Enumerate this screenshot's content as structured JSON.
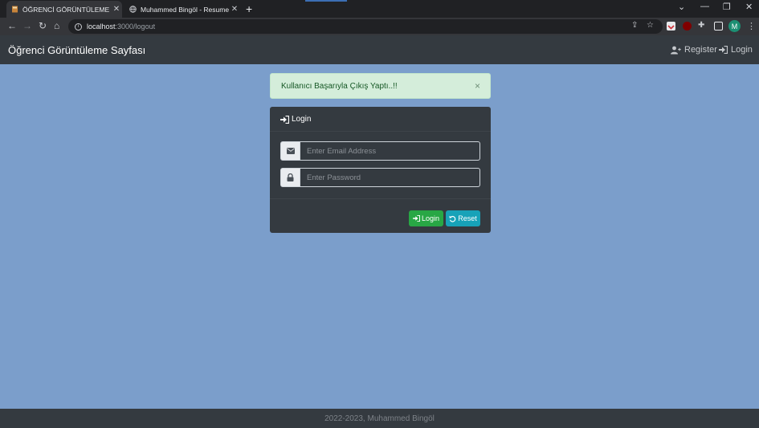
{
  "browser": {
    "tabs": [
      {
        "title": "ÖĞRENCİ GÖRÜNTÜLEME SAYFASI",
        "active": true
      },
      {
        "title": "Muhammed Bingöl - Resume Page",
        "active": false
      }
    ],
    "new_tab": "+",
    "address": {
      "host": "localhost",
      "path": ":3000/logout"
    },
    "profile_initial": "M"
  },
  "navbar": {
    "brand": "Öğrenci Görüntüleme Sayfası",
    "register_label": "Register",
    "login_label": "Login"
  },
  "alert": {
    "message": "Kullanıcı Başarıyla Çıkış Yaptı..!!",
    "close": "×"
  },
  "login_card": {
    "title": "Login",
    "email_placeholder": "Enter Email Address",
    "password_placeholder": "Enter Password",
    "login_button": "Login",
    "reset_button": "Reset"
  },
  "footer": {
    "text": "2022-2023, Muhammed Bingöl"
  },
  "colors": {
    "page_bg": "#7b9ecb",
    "dark": "#343a40",
    "success": "#28a745",
    "info": "#17a2b8",
    "alert_bg": "#d4edda"
  }
}
